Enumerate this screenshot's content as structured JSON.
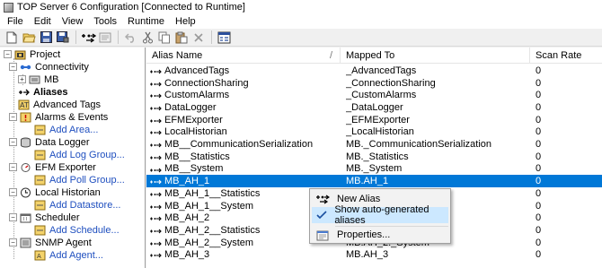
{
  "window": {
    "title": "TOP Server 6 Configuration [Connected to Runtime]"
  },
  "menu": [
    "File",
    "Edit",
    "View",
    "Tools",
    "Runtime",
    "Help"
  ],
  "toolbar": {
    "buttons": [
      "new-icon",
      "open-icon",
      "save-icon",
      "save-as-icon",
      "new-alias-icon",
      "properties-icon",
      "undo-icon",
      "cut-icon",
      "copy-icon",
      "paste-icon",
      "delete-icon",
      "quick-client-icon"
    ]
  },
  "tree": {
    "project": "Project",
    "connectivity": "Connectivity",
    "mb": "MB",
    "aliases": "Aliases",
    "advanced_tags": "Advanced Tags",
    "alarms_events": "Alarms & Events",
    "add_area": "Add Area...",
    "data_logger": "Data Logger",
    "add_log_group": "Add Log Group...",
    "efm_exporter": "EFM Exporter",
    "add_poll_group": "Add Poll Group...",
    "local_historian": "Local Historian",
    "add_datastore": "Add Datastore...",
    "scheduler": "Scheduler",
    "add_schedule": "Add Schedule...",
    "snmp_agent": "SNMP Agent",
    "add_agent": "Add Agent..."
  },
  "list": {
    "columns": {
      "alias_name": "Alias Name",
      "mapped_to": "Mapped To",
      "scan_rate": "Scan Rate"
    },
    "rows": [
      {
        "alias": "AdvancedTags",
        "mapped": "_AdvancedTags",
        "rate": "0"
      },
      {
        "alias": "ConnectionSharing",
        "mapped": "_ConnectionSharing",
        "rate": "0"
      },
      {
        "alias": "CustomAlarms",
        "mapped": "_CustomAlarms",
        "rate": "0"
      },
      {
        "alias": "DataLogger",
        "mapped": "_DataLogger",
        "rate": "0"
      },
      {
        "alias": "EFMExporter",
        "mapped": "_EFMExporter",
        "rate": "0"
      },
      {
        "alias": "LocalHistorian",
        "mapped": "_LocalHistorian",
        "rate": "0"
      },
      {
        "alias": "MB__CommunicationSerialization",
        "mapped": "MB._CommunicationSerialization",
        "rate": "0"
      },
      {
        "alias": "MB__Statistics",
        "mapped": "MB._Statistics",
        "rate": "0"
      },
      {
        "alias": "MB__System",
        "mapped": "MB._System",
        "rate": "0"
      },
      {
        "alias": "MB_AH_1",
        "mapped": "MB.AH_1",
        "rate": "0"
      },
      {
        "alias": "MB_AH_1__Statistics",
        "mapped": "",
        "rate": "0"
      },
      {
        "alias": "MB_AH_1__System",
        "mapped": "",
        "rate": "0"
      },
      {
        "alias": "MB_AH_2",
        "mapped": "",
        "rate": "0"
      },
      {
        "alias": "MB_AH_2__Statistics",
        "mapped": "",
        "rate": "0"
      },
      {
        "alias": "MB_AH_2__System",
        "mapped": "MB.AH_2._System",
        "rate": "0"
      },
      {
        "alias": "MB_AH_3",
        "mapped": "MB.AH_3",
        "rate": "0"
      }
    ]
  },
  "context_menu": {
    "new_alias": "New Alias",
    "show_auto": "Show auto-generated aliases",
    "properties": "Properties..."
  },
  "colors": {
    "selection": "#0078d7",
    "link": "#1f4fbf"
  }
}
